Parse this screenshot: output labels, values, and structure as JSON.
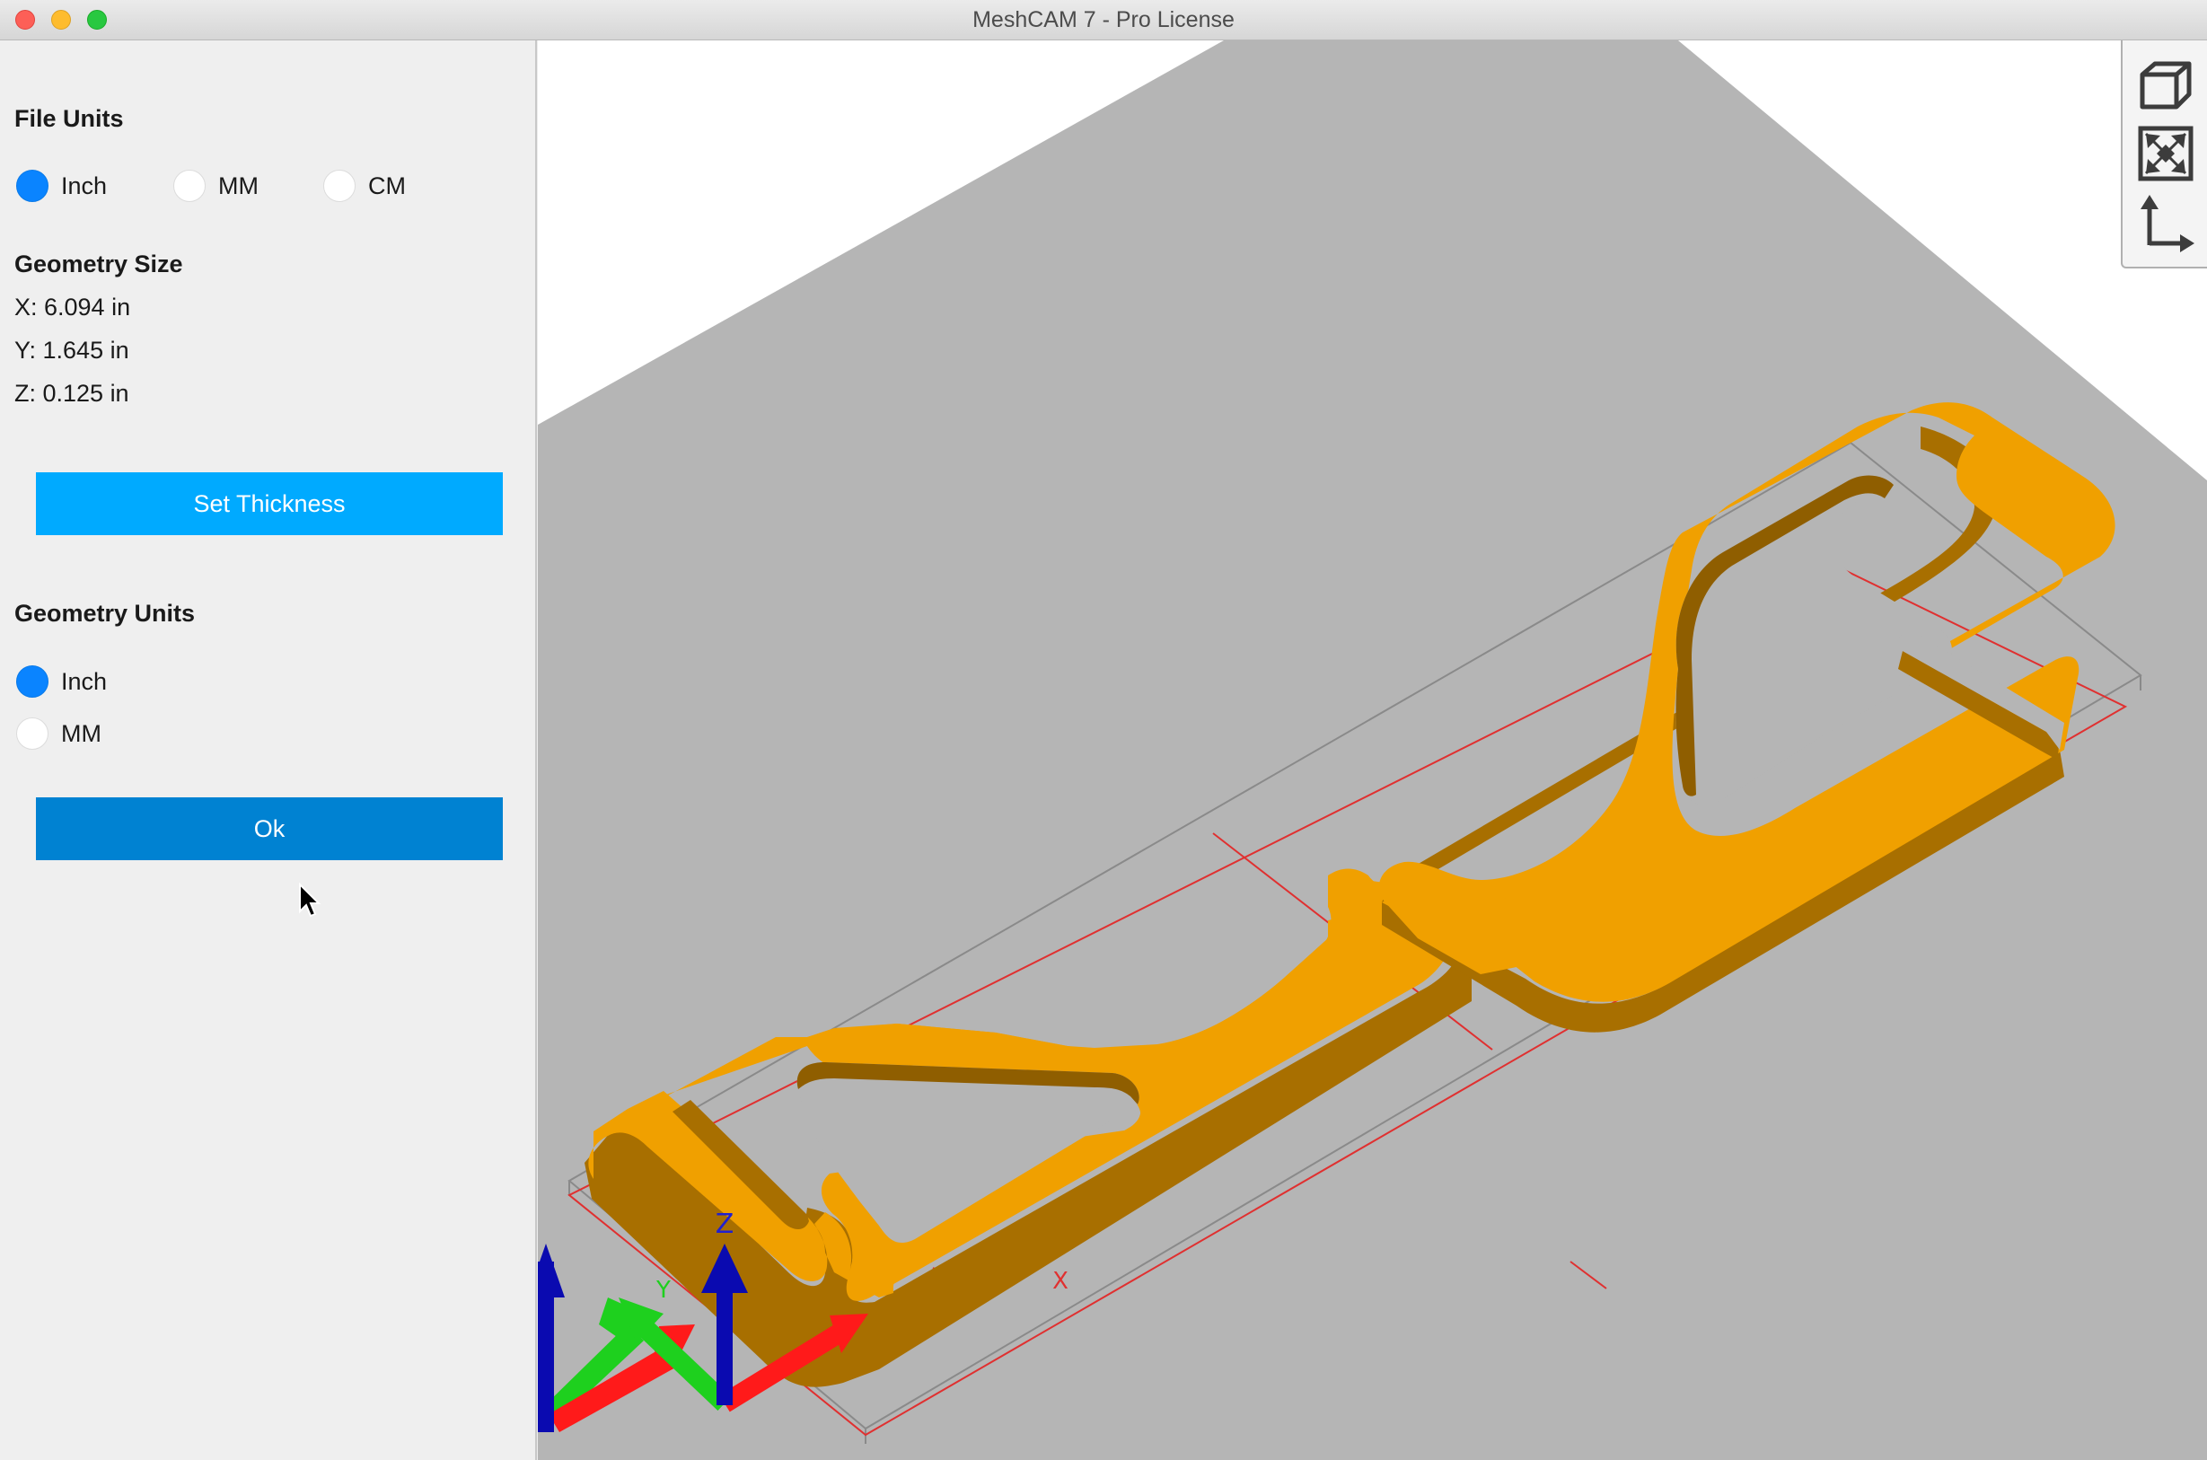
{
  "window": {
    "title": "MeshCAM 7 - Pro License"
  },
  "panel": {
    "file_units": {
      "heading": "File Units",
      "options": [
        "Inch",
        "MM",
        "CM"
      ],
      "selected": "Inch"
    },
    "geometry_size": {
      "heading": "Geometry Size",
      "x": "X: 6.094 in",
      "y": "Y: 1.645 in",
      "z": "Z: 0.125 in"
    },
    "set_thickness_label": "Set Thickness",
    "geometry_units": {
      "heading": "Geometry Units",
      "options": [
        "Inch",
        "MM"
      ],
      "selected": "Inch"
    },
    "ok_label": "Ok"
  },
  "viewport": {
    "axis_labels": {
      "x": "X",
      "y": "Y",
      "z": "Z"
    },
    "colors": {
      "part": "#f0a000",
      "part_side": "#b87a00",
      "stock_plane": "#b5b5b5",
      "bbox_line": "#e03030",
      "x_axis": "#ff1a1a",
      "y_axis": "#1ed01e",
      "z_axis": "#0a0ab0"
    },
    "toolbar": {
      "icons": [
        "cube-view-icon",
        "zoom-fit-icon",
        "axis-orientation-icon"
      ]
    }
  },
  "colors": {
    "selected_radio": "#0a84ff",
    "set_thickness_button": "#00aaff",
    "ok_button": "#0082d2"
  }
}
